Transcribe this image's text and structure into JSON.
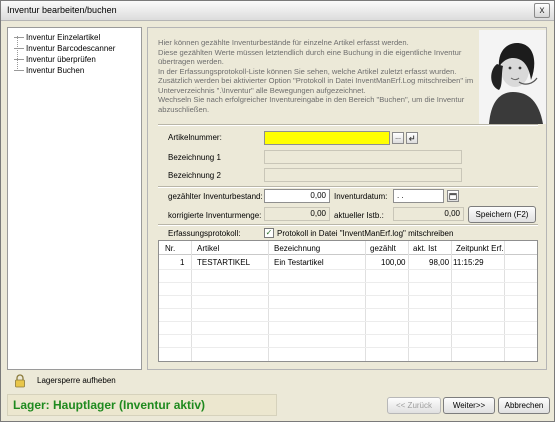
{
  "window": {
    "title": "Inventur bearbeiten/buchen",
    "close_glyph": "x"
  },
  "nav": {
    "items": [
      {
        "label": "Inventur Einzelartikel"
      },
      {
        "label": "Inventur Barcodescanner"
      },
      {
        "label": "Inventur überprüfen"
      },
      {
        "label": "Inventur Buchen"
      }
    ],
    "lock_icon": "padlock-icon",
    "lock_label": "Lagersperre aufheben"
  },
  "info_text": "Hier können gezählte Inventurbestände für einzelne Artikel erfasst werden.\nDiese gezählten Werte müssen letztendlich durch eine Buchung in die eigentliche Inventur übertragen werden.\nIn der Erfassungsprotokoll-Liste können Sie sehen, welche Artikel zuletzt erfasst wurden.\nZusätzlich werden bei aktivierter Option \"Protokoll in Datei InventManErf.Log mitschreiben\" im Unterverzeichnis \".\\Inventur\" alle Bewegungen aufgezeichnet.\nWechseln Sie nach erfolgreicher Inventureingabe in den Bereich \"Buchen\", um die Inventur abzuschließen.",
  "form": {
    "artikelnummer_label": "Artikelnummer:",
    "artikelnummer_value": "",
    "browse_glyph": "...",
    "lookup_icon": "arrow-enter-icon",
    "bezeichnung1_label": "Bezeichnung 1",
    "bezeichnung1_value": "",
    "bezeichnung2_label": "Bezeichnung 2",
    "bezeichnung2_value": "",
    "gezaehlt_label": "gezählter Inventurbestand:",
    "gezaehlt_value": "0,00",
    "inventurdatum_label": "Inventurdatum:",
    "inventurdatum_value": " .  .",
    "calendar_icon": "calendar-icon",
    "korrigiert_label": "korrigierte Inventurmenge:",
    "korrigiert_value": "0,00",
    "aktuell_label": "aktueller Istb.:",
    "aktuell_value": "0,00",
    "save_label": "Speichern (F2)"
  },
  "protocol": {
    "label": "Erfassungsprotokoll:",
    "checkbox_checked": true,
    "checkbox_label": "Protokoll in Datei \"InventManErf.log\" mitschreiben",
    "columns": [
      "Nr.",
      "Artikel",
      "Bezeichnung",
      "gezählt",
      "akt. Ist",
      "Zeitpunkt Erf."
    ],
    "rows": [
      {
        "nr": "1",
        "artikel": "TESTARTIKEL",
        "bezeichnung": "Ein Testartikel",
        "gezaehlt": "100,00",
        "akt_ist": "98,00",
        "zeitpunkt": "11:15:29"
      }
    ]
  },
  "status": {
    "text": "Lager: Hauptlager (Inventur aktiv)",
    "color": "#1f8a1f"
  },
  "buttons": {
    "back": "<< Zurück",
    "next": "Weiter>>",
    "cancel": "Abbrechen"
  }
}
